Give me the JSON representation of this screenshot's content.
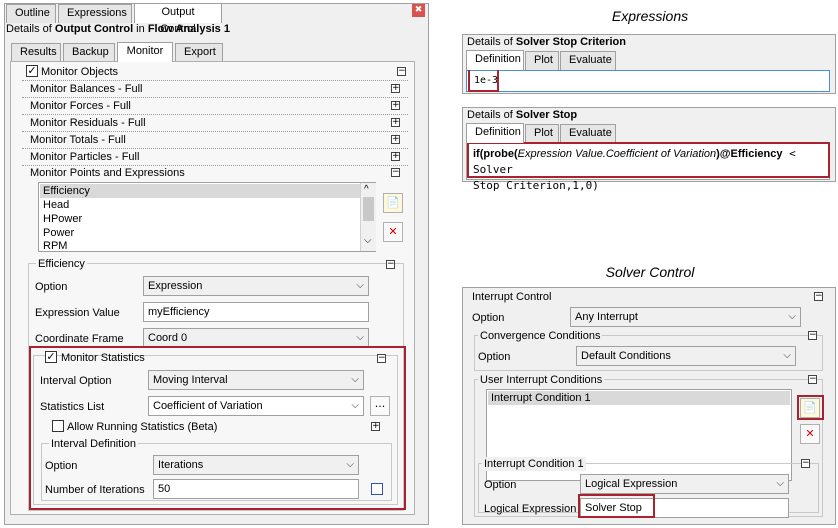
{
  "left_panel": {
    "tabs": [
      "Outline",
      "Expressions",
      "Output Control"
    ],
    "close_glyph": "✖",
    "details_prefix": "Details of ",
    "details_obj": "Output Control",
    "details_mid": " in ",
    "details_scope": "Flow Analysis 1",
    "sub_tabs": [
      "Results",
      "Backup",
      "Monitor",
      "Export"
    ],
    "monitor_objects": "Monitor Objects",
    "rows": [
      "Monitor Balances - Full",
      "Monitor Forces - Full",
      "Monitor Residuals - Full",
      "Monitor Totals - Full",
      "Monitor Particles - Full",
      "Monitor Points and Expressions"
    ],
    "list_items": [
      "Efficiency",
      "Head",
      "HPower",
      "Power",
      "RPM"
    ],
    "efficiency_header": "Efficiency",
    "option_label": "Option",
    "option_value": "Expression",
    "expr_value_label": "Expression Value",
    "expr_value": "myEfficiency",
    "coord_label": "Coordinate Frame",
    "coord_value": "Coord 0",
    "monitor_statistics": "Monitor Statistics",
    "interval_option_label": "Interval Option",
    "interval_option_value": "Moving Interval",
    "stats_list_label": "Statistics List",
    "stats_list_value": "Coefficient of Variation",
    "ellipsis": "...",
    "allow_running": "Allow Running Statistics (Beta)",
    "interval_def": "Interval Definition",
    "id_option_label": "Option",
    "id_option_value": "Iterations",
    "num_iter_label": "Number of Iterations",
    "num_iter_value": "50"
  },
  "expressions": {
    "heading": "Expressions",
    "p1": {
      "prefix": "Details of ",
      "obj": "Solver Stop Criterion",
      "tabs": [
        "Definition",
        "Plot",
        "Evaluate"
      ],
      "value": "1e-3"
    },
    "p2": {
      "prefix": "Details of ",
      "obj": "Solver Stop",
      "tabs": [
        "Definition",
        "Plot",
        "Evaluate"
      ],
      "line1_a": "if(probe(",
      "line1_b": "Expression Value.Coefficient of Variation",
      "line1_c": ")@Efficiency",
      "line1_d": " < Solver",
      "line2": "Stop Criterion,1,0)"
    }
  },
  "solver_control": {
    "heading": "Solver Control",
    "interrupt_control": "Interrupt Control",
    "option_label": "Option",
    "option_value": "Any Interrupt",
    "conv_cond": "Convergence Conditions",
    "conv_option_label": "Option",
    "conv_option_value": "Default Conditions",
    "user_cond": "User Interrupt Conditions",
    "list_items": [
      "Interrupt Condition 1"
    ],
    "ic1_header": "Interrupt Condition 1",
    "ic1_option_label": "Option",
    "ic1_option_value": "Logical Expression",
    "logical_label": "Logical Expression",
    "logical_value": "Solver Stop"
  },
  "glyphs": {
    "minus": "−",
    "plus": "+",
    "check": "✓",
    "down": "⌵",
    "up": "^",
    "new_icon": "📄",
    "delete_icon": "✕"
  }
}
